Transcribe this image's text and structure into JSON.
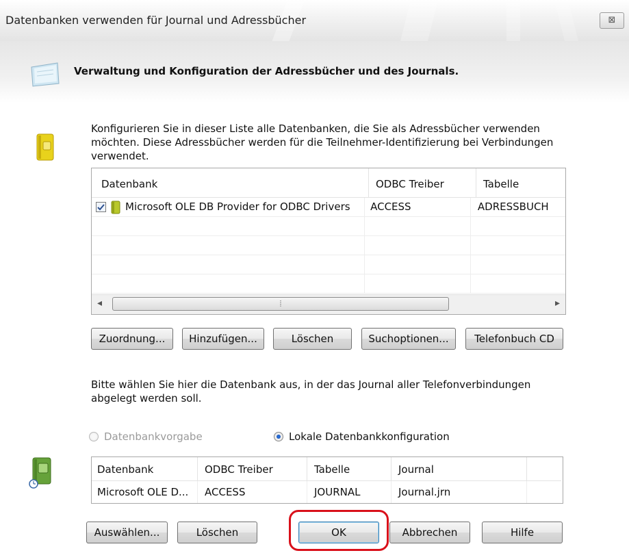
{
  "window": {
    "title": "Datenbanken verwenden für Journal und Adressbücher",
    "close_glyph": "⊠"
  },
  "header": {
    "title": "Verwaltung und Konfiguration der Adressbücher und des Journals.",
    "icon": "notebook-icon"
  },
  "addressbooks": {
    "icon": "yellow-book-icon",
    "intro_lines": [
      "Konfigurieren Sie in dieser Liste alle Datenbanken, die Sie als Adressbücher verwenden",
      "möchten. Diese Adressbücher werden für die Teilnehmer-Identifizierung bei Verbindungen",
      "verwendet."
    ],
    "columns": [
      "Datenbank",
      "ODBC Treiber",
      "Tabelle"
    ],
    "rows": [
      {
        "checked": true,
        "icon": "green-book-icon",
        "cells": [
          "Microsoft OLE DB Provider for ODBC Drivers",
          "ACCESS",
          "ADRESSBUCH"
        ]
      }
    ],
    "scroll_left_glyph": "◂",
    "scroll_right_glyph": "▸",
    "scroll_thumb_glyph": "⦙",
    "buttons": [
      "Zuordnung...",
      "Hinzufügen...",
      "Löschen",
      "Suchoptionen...",
      "Telefonbuch CD"
    ]
  },
  "journal": {
    "icon": "green-journal-icon",
    "intro_lines": [
      "Bitte wählen Sie hier die Datenbank aus, in der das Journal aller Telefonverbindungen",
      "abgelegt werden soll."
    ],
    "radio_default": {
      "label": "Datenbankvorgabe",
      "checked": false,
      "disabled": true
    },
    "radio_local": {
      "label": "Lokale Datenbankkonfiguration",
      "checked": true,
      "disabled": false
    },
    "columns": [
      "Datenbank",
      "ODBC Treiber",
      "Tabelle",
      "Journal"
    ],
    "rows": [
      {
        "cells": [
          "Microsoft OLE D...",
          "ACCESS",
          "JOURNAL",
          "Journal.jrn"
        ]
      }
    ]
  },
  "footer": {
    "buttons": [
      "Auswählen...",
      "Löschen",
      "OK",
      "Abbrechen",
      "Hilfe"
    ],
    "highlight_color": "#d9101a"
  }
}
